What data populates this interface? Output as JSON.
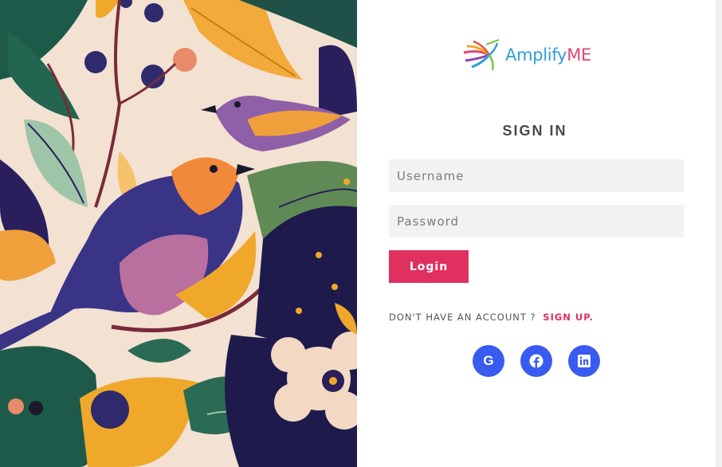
{
  "brand": {
    "name_main": "Amplify",
    "name_accent": "ME",
    "colors": {
      "primary": "#2f9ed8",
      "accent": "#e0476f"
    }
  },
  "signin": {
    "title": "SIGN IN",
    "username_placeholder": "Username",
    "password_placeholder": "Password",
    "login_label": "Login",
    "no_account_text": "DON'T HAVE AN ACCOUNT ?",
    "signup_label": "SIGN UP."
  },
  "social": [
    {
      "name": "google",
      "icon": "google-icon"
    },
    {
      "name": "facebook",
      "icon": "facebook-icon"
    },
    {
      "name": "linkedin",
      "icon": "linkedin-icon"
    }
  ],
  "colors": {
    "button": "#e0305f",
    "social": "#3a5bf0",
    "field_bg": "#f2f2f2"
  },
  "hero": {
    "illustration": "birds-and-flowers-illustration"
  }
}
